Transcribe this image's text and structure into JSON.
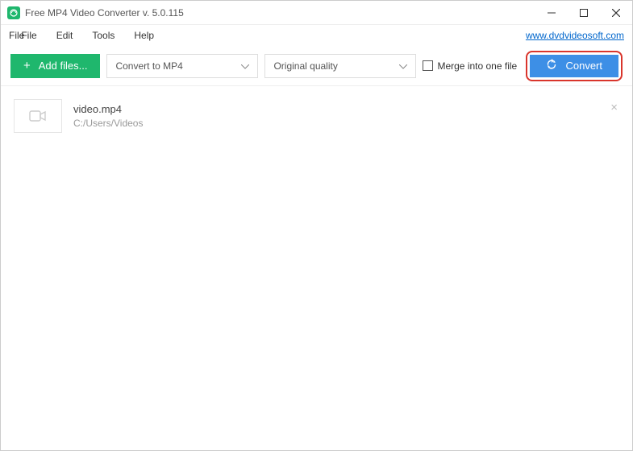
{
  "titlebar": {
    "title": "Free MP4 Video Converter v. 5.0.115"
  },
  "menubar": {
    "file": "File",
    "edit": "Edit",
    "tools": "Tools",
    "help": "Help",
    "link": "www.dvdvideosoft.com"
  },
  "toolbar": {
    "add_files": "Add files...",
    "format_dropdown": "Convert to MP4",
    "quality_dropdown": "Original quality",
    "merge_label": "Merge into one file",
    "convert": "Convert"
  },
  "file": {
    "name": "video.mp4",
    "path": "C:/Users/Videos"
  }
}
